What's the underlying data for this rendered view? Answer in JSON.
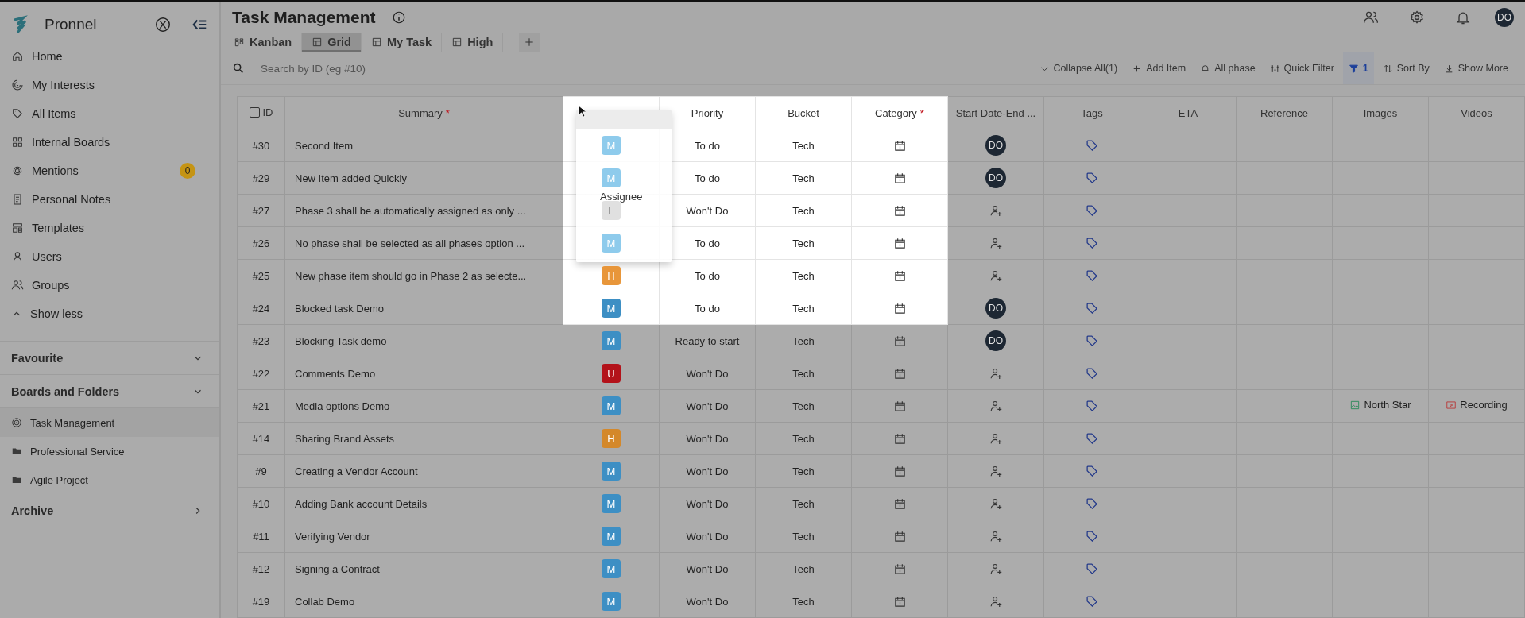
{
  "sidebar": {
    "brand": "Pronnel",
    "items": [
      {
        "label": "Home"
      },
      {
        "label": "My Interests"
      },
      {
        "label": "All Items"
      },
      {
        "label": "Internal Boards"
      },
      {
        "label": "Mentions",
        "badge": "0"
      },
      {
        "label": "Personal Notes"
      },
      {
        "label": "Templates"
      },
      {
        "label": "Users"
      },
      {
        "label": "Groups"
      }
    ],
    "show_less": "Show less",
    "sections": [
      {
        "label": "Favourite",
        "expanded": true
      },
      {
        "label": "Boards and Folders",
        "expanded": true,
        "children": [
          {
            "label": "Task Management",
            "kind": "board",
            "selected": true
          },
          {
            "label": "Professional Service",
            "kind": "folder",
            "selected": false
          },
          {
            "label": "Agile Project",
            "kind": "folder",
            "selected": false
          }
        ]
      },
      {
        "label": "Archive",
        "expanded": false
      }
    ]
  },
  "header": {
    "title": "Task Management",
    "user_initials": "DO"
  },
  "tabs": [
    {
      "label": "Kanban",
      "kind": "kanban",
      "selected": false
    },
    {
      "label": "Grid",
      "kind": "grid",
      "selected": true
    },
    {
      "label": "My Task",
      "kind": "grid",
      "selected": false
    },
    {
      "label": "High",
      "kind": "grid",
      "selected": false
    }
  ],
  "search": {
    "placeholder": "Search by ID (eg #10)"
  },
  "toolbar": [
    {
      "label": "Collapse All(1)",
      "kind": "collapse",
      "active": false
    },
    {
      "label": "Add Item",
      "kind": "add",
      "active": false
    },
    {
      "label": "All phase",
      "kind": "phase",
      "active": false
    },
    {
      "label": "Quick Filter",
      "kind": "quick",
      "active": false
    },
    {
      "label": "1",
      "kind": "filter",
      "active": true
    },
    {
      "label": "Sort By",
      "kind": "sort",
      "active": false
    },
    {
      "label": "Show More",
      "kind": "more",
      "active": false
    }
  ],
  "table": {
    "select_all": {
      "checked": false
    },
    "drag_ghost": {
      "label": "Assignee"
    },
    "columns": [
      {
        "label": "ID",
        "kind": "id",
        "highlighted": false
      },
      {
        "label": "Summary",
        "kind": "summary",
        "required_mark": "*",
        "highlighted": false
      },
      {
        "kind": "assignee",
        "highlighted": true
      },
      {
        "label": "Priority",
        "kind": "priority",
        "highlighted": true
      },
      {
        "label": "Bucket",
        "kind": "bucket",
        "highlighted": true
      },
      {
        "label": "Category",
        "kind": "calendar",
        "required_mark": "*",
        "highlighted": true
      },
      {
        "label": "Start Date-End ...",
        "kind": "start",
        "highlighted": false
      },
      {
        "label": "Tags",
        "kind": "tag",
        "highlighted": false
      },
      {
        "label": "ETA",
        "kind": "empty",
        "highlighted": false
      },
      {
        "label": "Reference",
        "kind": "empty",
        "highlighted": false
      },
      {
        "label": "Images",
        "kind": "image",
        "highlighted": false
      },
      {
        "label": "Videos",
        "kind": "video",
        "highlighted": false
      }
    ],
    "rows": [
      {
        "id": "#30",
        "summary": "Second Item",
        "assignee": {
          "letter": "M",
          "color": "#8ecbec"
        },
        "priority": "To do",
        "bucket": "Tech",
        "start": {
          "kind": "avatar",
          "initials": "DO"
        },
        "highlighted": true
      },
      {
        "id": "#29",
        "summary": "New Item added Quickly",
        "assignee": {
          "letter": "M",
          "color": "#8ecbec"
        },
        "priority": "To do",
        "bucket": "Tech",
        "start": {
          "kind": "avatar",
          "initials": "DO"
        },
        "highlighted": true
      },
      {
        "id": "#27",
        "summary": "Phase 3 shall be automatically assigned as only ...",
        "assignee": {
          "letter": "L",
          "color": "#e0e0e0"
        },
        "priority": "Won't Do",
        "bucket": "Tech",
        "start": {
          "kind": "add"
        },
        "highlighted": true
      },
      {
        "id": "#26",
        "summary": "No phase shall be selected as all phases option ...",
        "assignee": {
          "letter": "M",
          "color": "#8ecbec"
        },
        "priority": "To do",
        "bucket": "Tech",
        "start": {
          "kind": "add"
        },
        "highlighted": true
      },
      {
        "id": "#25",
        "summary": "New phase item should go in Phase 2 as selecte...",
        "assignee": {
          "letter": "H",
          "color": "#e8963a"
        },
        "priority": "To do",
        "bucket": "Tech",
        "start": {
          "kind": "add"
        },
        "highlighted": true
      },
      {
        "id": "#24",
        "summary": "Blocked task Demo",
        "assignee": {
          "letter": "M",
          "color": "#3d8fc4"
        },
        "priority": "To do",
        "bucket": "Tech",
        "start": {
          "kind": "avatar",
          "initials": "DO"
        },
        "highlighted": true
      },
      {
        "id": "#23",
        "summary": "Blocking Task demo",
        "assignee": {
          "letter": "M",
          "color": "#3d8fc4"
        },
        "priority": "Ready to start",
        "bucket": "Tech",
        "start": {
          "kind": "avatar",
          "initials": "DO"
        },
        "highlighted": false
      },
      {
        "id": "#22",
        "summary": "Comments Demo",
        "assignee": {
          "letter": "U",
          "color": "#b3121a"
        },
        "priority": "Won't Do",
        "bucket": "Tech",
        "start": {
          "kind": "add"
        },
        "highlighted": false
      },
      {
        "id": "#21",
        "summary": "Media options Demo",
        "assignee": {
          "letter": "M",
          "color": "#3d8fc4"
        },
        "priority": "Won't Do",
        "bucket": "Tech",
        "start": {
          "kind": "add"
        },
        "image": "North Star",
        "video": "Recording",
        "highlighted": false
      },
      {
        "id": "#14",
        "summary": "Sharing Brand Assets",
        "assignee": {
          "letter": "H",
          "color": "#d4882a"
        },
        "priority": "Won't Do",
        "bucket": "Tech",
        "start": {
          "kind": "add"
        },
        "highlighted": false
      },
      {
        "id": "#9",
        "summary": "Creating a Vendor Account",
        "assignee": {
          "letter": "M",
          "color": "#3d8fc4"
        },
        "priority": "Won't Do",
        "bucket": "Tech",
        "start": {
          "kind": "add"
        },
        "highlighted": false
      },
      {
        "id": "#10",
        "summary": "Adding Bank account Details",
        "assignee": {
          "letter": "M",
          "color": "#3d8fc4"
        },
        "priority": "Won't Do",
        "bucket": "Tech",
        "start": {
          "kind": "add"
        },
        "highlighted": false
      },
      {
        "id": "#11",
        "summary": "Verifying Vendor",
        "assignee": {
          "letter": "M",
          "color": "#3d8fc4"
        },
        "priority": "Won't Do",
        "bucket": "Tech",
        "start": {
          "kind": "add"
        },
        "highlighted": false
      },
      {
        "id": "#12",
        "summary": "Signing a Contract",
        "assignee": {
          "letter": "M",
          "color": "#3d8fc4"
        },
        "priority": "Won't Do",
        "bucket": "Tech",
        "start": {
          "kind": "add"
        },
        "highlighted": false
      },
      {
        "id": "#19",
        "summary": "Collab Demo",
        "assignee": {
          "letter": "M",
          "color": "#3d8fc4"
        },
        "priority": "Won't Do",
        "bucket": "Tech",
        "start": {
          "kind": "add"
        },
        "highlighted": false
      }
    ]
  }
}
